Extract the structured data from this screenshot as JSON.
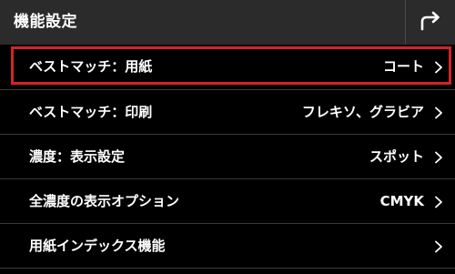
{
  "header": {
    "title": "機能設定",
    "back_icon": "return-arrow-icon"
  },
  "list": {
    "items": [
      {
        "label": "ベストマッチ：用紙",
        "value": "コート",
        "selected": true
      },
      {
        "label": "ベストマッチ：印刷",
        "value": "フレキソ、グラビア",
        "selected": false
      },
      {
        "label": "濃度：表示設定",
        "value": "スポット",
        "selected": false
      },
      {
        "label": "全濃度の表示オプション",
        "value": "CMYK",
        "selected": false
      },
      {
        "label": "用紙インデックス機能",
        "value": "",
        "selected": false
      }
    ]
  },
  "colors": {
    "header_bg": "#2b2b2b",
    "selection_border": "#d3232c",
    "text": "#ffffff"
  }
}
